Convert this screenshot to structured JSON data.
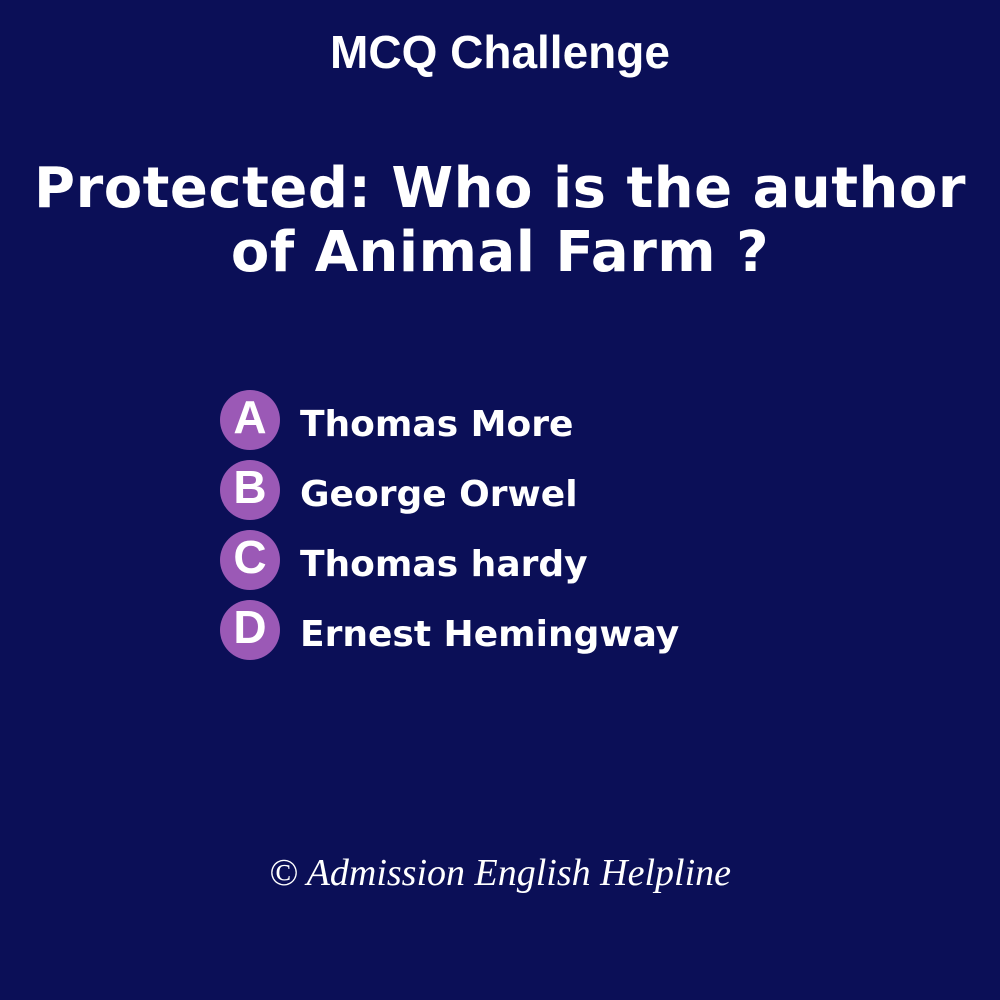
{
  "header": {
    "title": "MCQ Challenge"
  },
  "question": {
    "text": "Protected: Who is the author of Animal Farm ?"
  },
  "options": [
    {
      "letter": "A",
      "text": "Thomas More"
    },
    {
      "letter": "B",
      "text": "George Orwel"
    },
    {
      "letter": "C",
      "text": "Thomas hardy"
    },
    {
      "letter": "D",
      "text": "Ernest Hemingway"
    }
  ],
  "footer": {
    "text": "© Admission English Helpline"
  },
  "colors": {
    "background": "#0b0f57",
    "badge": "#9b59b6",
    "text": "#ffffff"
  }
}
